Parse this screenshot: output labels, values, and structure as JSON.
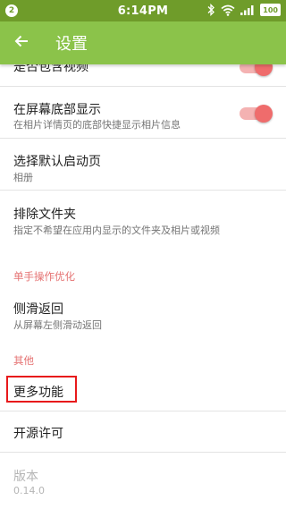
{
  "status_bar": {
    "notification_count": "2",
    "time": "6:14PM",
    "battery": "100",
    "icons": [
      "bluetooth-icon",
      "wifi-icon",
      "signal-icon",
      "battery-icon"
    ],
    "background": "#6f9c2a"
  },
  "app_bar": {
    "title": "设置",
    "back_icon": "arrow-back-icon",
    "background": "#8bc34a"
  },
  "settings": {
    "include_videos": {
      "title": "是否包含视频",
      "toggle_on": true
    },
    "bottom_display": {
      "title": "在屏幕底部显示",
      "summary": "在相片详情页的底部快捷显示相片信息",
      "toggle_on": true
    },
    "default_page": {
      "title": "选择默认启动页",
      "summary": "相册"
    },
    "exclude_folders": {
      "title": "排除文件夹",
      "summary": "指定不希望在应用内显示的文件夹及相片或视频"
    },
    "one_hand_header": "单手操作优化",
    "swipe_back": {
      "title": "侧滑返回",
      "summary": "从屏幕左侧滑动返回"
    },
    "other_header": "其他",
    "more_features": {
      "title": "更多功能"
    },
    "open_source": {
      "title": "开源许可"
    },
    "version": {
      "title": "版本",
      "summary": "0.14.0"
    }
  },
  "colors": {
    "accent": "#e57373",
    "highlight": "#e8191b"
  }
}
